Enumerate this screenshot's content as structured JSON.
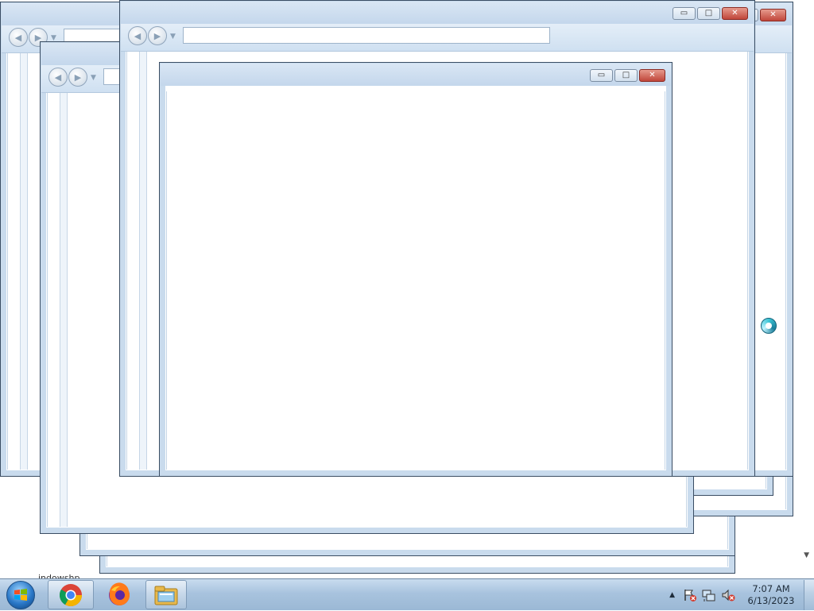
{
  "windows": [
    {
      "close_label": "✕",
      "minimize_label": "▭",
      "maximize_label": "□"
    }
  ],
  "desktop": {
    "background_fragment_text": "indowshp"
  },
  "taskbar": {
    "start_label": "Start",
    "pinned": [
      {
        "name": "Google Chrome",
        "icon": "chrome-icon"
      },
      {
        "name": "Firefox",
        "icon": "firefox-icon"
      },
      {
        "name": "Windows Explorer",
        "icon": "folder-icon"
      }
    ],
    "tray": {
      "chevron": "▲",
      "time": "7:07 AM",
      "date": "6/13/2023"
    }
  },
  "colors": {
    "window_frame": "#c9dbed",
    "window_border": "#3a4d63",
    "close_button": "#c0463a",
    "taskbar": "#a8c3de"
  }
}
